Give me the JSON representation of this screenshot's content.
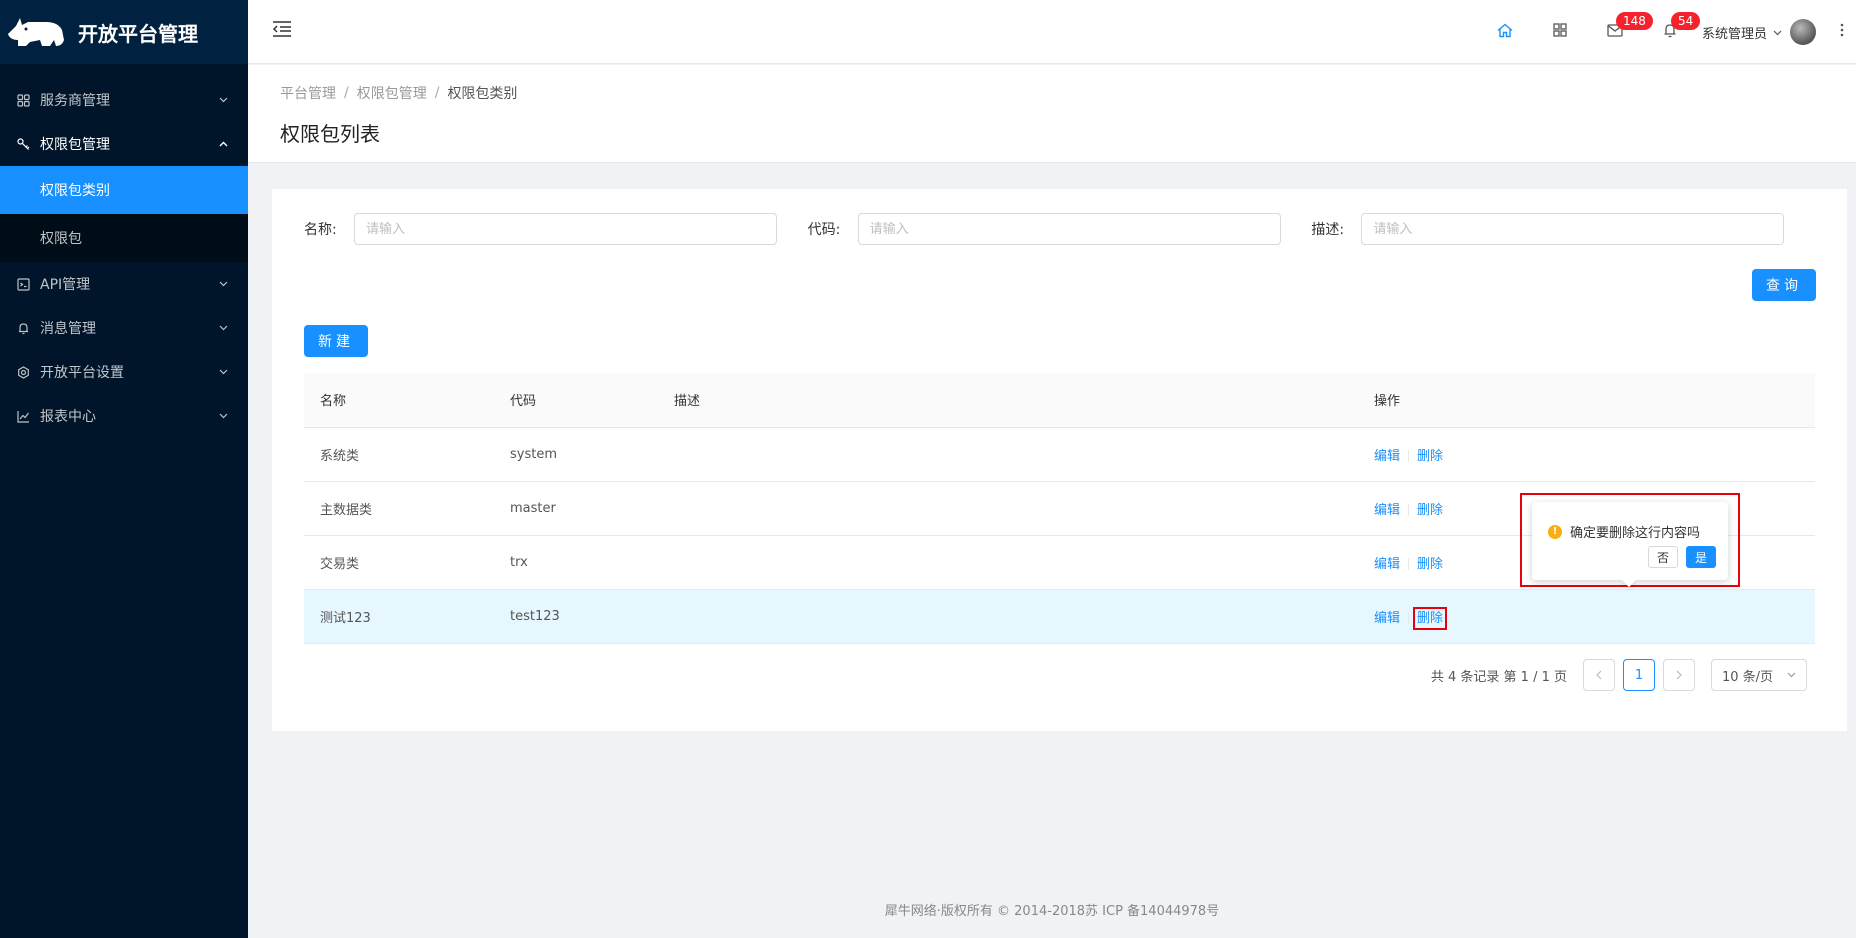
{
  "app": {
    "title": "开放平台管理"
  },
  "sidebar": {
    "items": [
      {
        "label": "服务商管理",
        "icon": "cluster-icon"
      },
      {
        "label": "权限包管理",
        "icon": "key-icon",
        "open": true,
        "children": [
          {
            "label": "权限包类别",
            "active": true
          },
          {
            "label": "权限包"
          }
        ]
      },
      {
        "label": "API管理",
        "icon": "code-icon"
      },
      {
        "label": "消息管理",
        "icon": "bell-icon"
      },
      {
        "label": "开放平台设置",
        "icon": "gear-icon"
      },
      {
        "label": "报表中心",
        "icon": "line-chart-icon"
      }
    ]
  },
  "header": {
    "mail_badge": "148",
    "bell_badge": "54",
    "user_name": "系统管理员"
  },
  "breadcrumb": {
    "items": [
      "平台管理",
      "权限包管理",
      "权限包类别"
    ]
  },
  "page": {
    "title": "权限包列表"
  },
  "search": {
    "name_label": "名称:",
    "code_label": "代码:",
    "desc_label": "描述:",
    "placeholder": "请输入",
    "query_button": "查询"
  },
  "toolbar": {
    "new_button": "新建"
  },
  "table": {
    "columns": [
      "名称",
      "代码",
      "描述",
      "操作"
    ],
    "rows": [
      {
        "name": "系统类",
        "code": "system",
        "desc": ""
      },
      {
        "name": "主数据类",
        "code": "master",
        "desc": ""
      },
      {
        "name": "交易类",
        "code": "trx",
        "desc": ""
      },
      {
        "name": "测试123",
        "code": "test123",
        "desc": ""
      }
    ],
    "edit_label": "编辑",
    "delete_label": "删除"
  },
  "pagination": {
    "total_text": "共 4 条记录 第 1 / 1 页",
    "current_page": "1",
    "page_size": "10 条/页"
  },
  "popconfirm": {
    "message": "确定要删除这行内容吗",
    "cancel": "否",
    "ok": "是"
  },
  "footer": {
    "text": "犀牛网络·版权所有 © 2014-2018苏 ICP 备14044978号"
  },
  "colors": {
    "primary": "#1890ff",
    "sidebar_bg": "#001529",
    "badge": "#f5222d",
    "highlight": "#e8000b"
  }
}
